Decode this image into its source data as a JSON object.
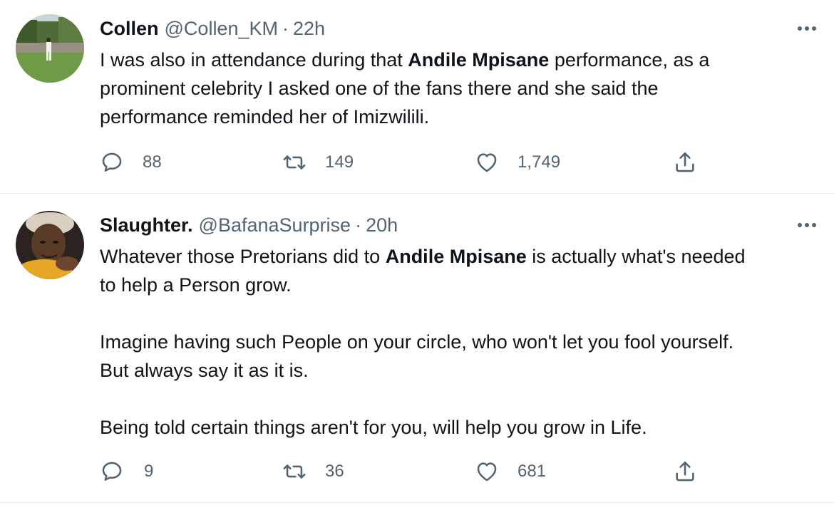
{
  "tweets": [
    {
      "display_name": "Collen",
      "handle": "@Collen_KM",
      "separator": "·",
      "time": "22h",
      "more_icon": "more-horizontal-icon",
      "text_segments": [
        {
          "text": "I was also in attendance during that ",
          "bold": false
        },
        {
          "text": "Andile Mpisane",
          "bold": true
        },
        {
          "text": " performance, as a\nprominent celebrity I asked one of the fans there and she said the\nperformance reminded her of Imizwilili.",
          "bold": false
        }
      ],
      "actions": {
        "reply_count": "88",
        "retweet_count": "149",
        "like_count": "1,749"
      }
    },
    {
      "display_name": "Slaughter.",
      "handle": "@BafanaSurprise",
      "separator": "·",
      "time": "20h",
      "more_icon": "more-horizontal-icon",
      "text_segments": [
        {
          "text": "Whatever those Pretorians did to ",
          "bold": false
        },
        {
          "text": "Andile Mpisane",
          "bold": true
        },
        {
          "text": " is actually what's needed\nto help a Person grow.\n\nImagine having such People on your circle, who won't let you fool yourself.\nBut always say it as it is.\n\nBeing told certain things aren't for you, will help you grow in Life.",
          "bold": false
        }
      ],
      "actions": {
        "reply_count": "9",
        "retweet_count": "36",
        "like_count": "681"
      }
    }
  ],
  "colors": {
    "text_primary": "#0f1419",
    "text_secondary": "#536471",
    "divider": "#e6ecf0"
  },
  "icons": {
    "reply": "reply-icon",
    "retweet": "retweet-icon",
    "like": "heart-icon",
    "share": "share-icon"
  }
}
